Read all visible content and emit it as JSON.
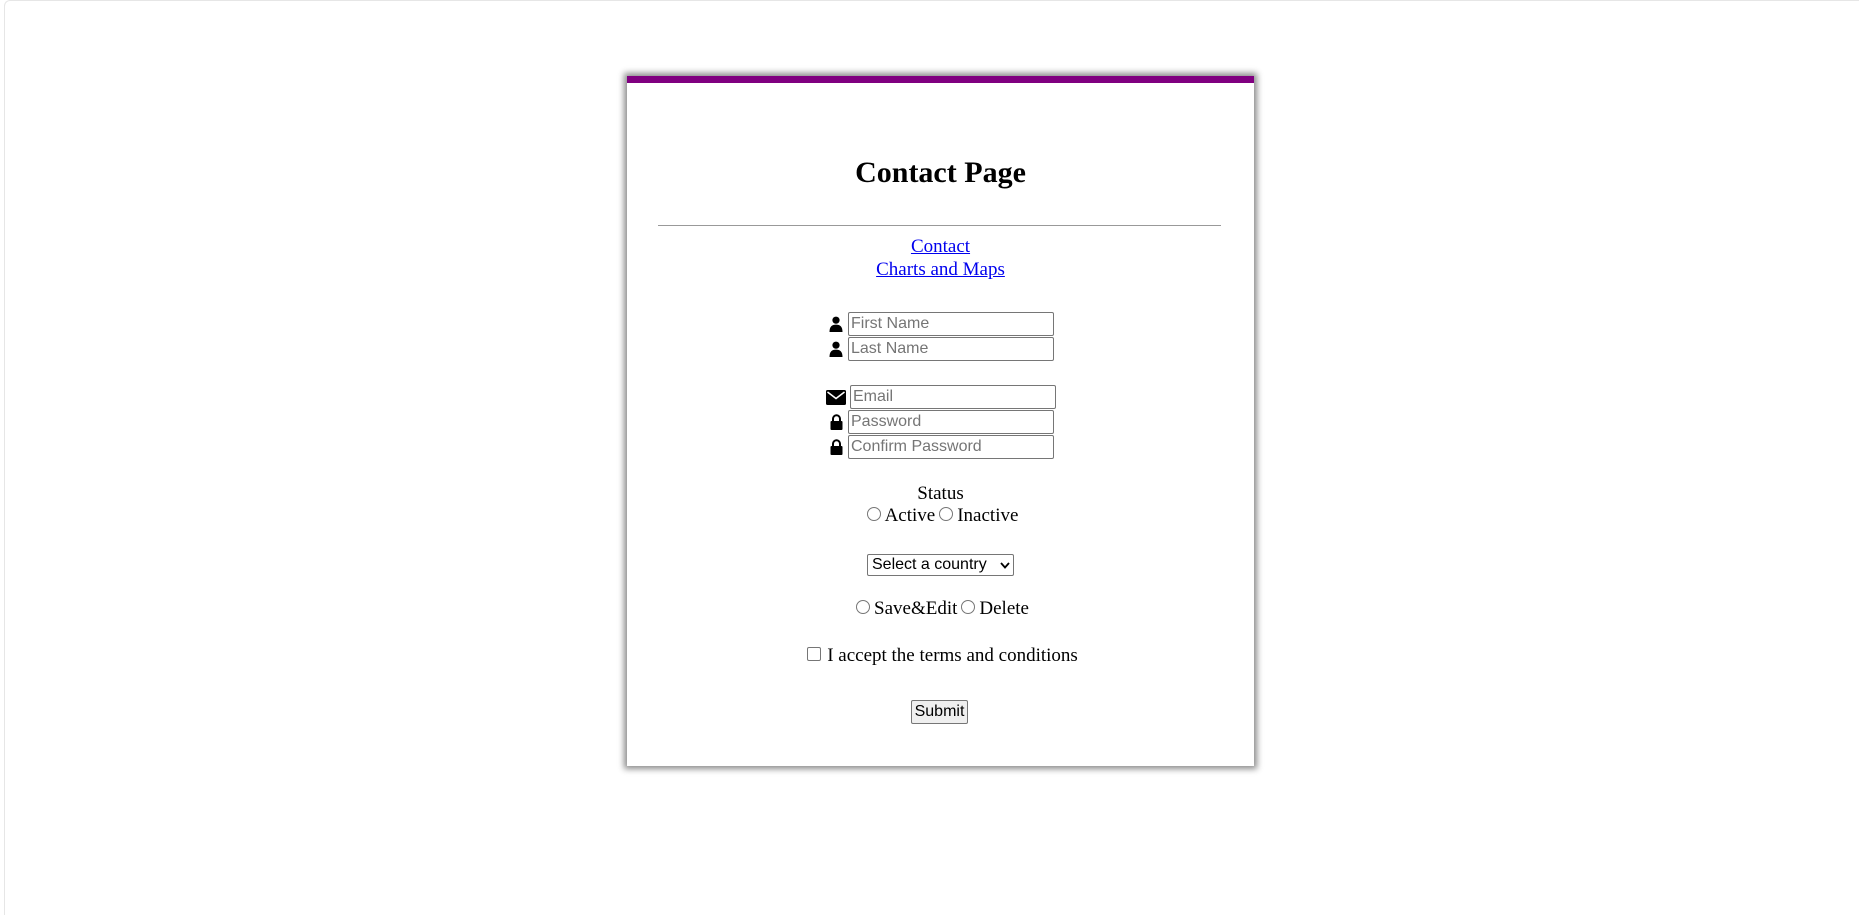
{
  "page": {
    "title": "Contact Page"
  },
  "nav": {
    "links": [
      "Contact",
      "Charts and Maps"
    ]
  },
  "form": {
    "first_name": {
      "placeholder": "First Name",
      "icon": "user-icon"
    },
    "last_name": {
      "placeholder": "Last Name",
      "icon": "user-icon"
    },
    "email": {
      "placeholder": "Email",
      "icon": "envelope-icon"
    },
    "password": {
      "placeholder": "Password",
      "icon": "lock-icon"
    },
    "confirm_password": {
      "placeholder": "Confirm Password",
      "icon": "lock-icon"
    },
    "status": {
      "label": "Status",
      "options": [
        "Active",
        "Inactive"
      ]
    },
    "country": {
      "selected": "Select a country"
    },
    "action": {
      "options": [
        "Save&Edit",
        "Delete"
      ]
    },
    "terms_label": "I accept the terms and conditions",
    "submit_label": "Submit"
  },
  "colors": {
    "accent": "#800080",
    "link": "#0000ee"
  }
}
